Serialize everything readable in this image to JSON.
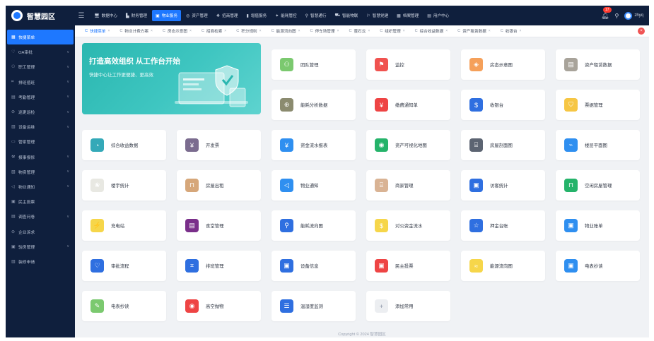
{
  "app": {
    "title": "智慧园区"
  },
  "header": {
    "nav": [
      {
        "label": "数据中心",
        "icon": "monitor-icon",
        "glyph": "🖥"
      },
      {
        "label": "财务管理",
        "icon": "chart-icon",
        "glyph": "▙"
      },
      {
        "label": "物业服务",
        "icon": "briefcase-icon",
        "glyph": "▣",
        "active": true
      },
      {
        "label": "资产管理",
        "icon": "asset-icon",
        "glyph": "◎"
      },
      {
        "label": "招商管理",
        "icon": "handshake-icon",
        "glyph": "❖"
      },
      {
        "label": "增值服务",
        "icon": "bar-icon",
        "glyph": "▮"
      },
      {
        "label": "能耗管控",
        "icon": "leaf-icon",
        "glyph": "✦"
      },
      {
        "label": "智慧通行",
        "icon": "pass-icon",
        "glyph": "⚲"
      },
      {
        "label": "智能物联",
        "icon": "car-icon",
        "glyph": "⛟"
      },
      {
        "label": "智慧党建",
        "icon": "flag-icon",
        "glyph": "⚐"
      },
      {
        "label": "档案管理",
        "icon": "archive-icon",
        "glyph": "▦"
      },
      {
        "label": "用户中心",
        "icon": "user-card-icon",
        "glyph": "▤"
      }
    ],
    "notification_count": "17",
    "username": "zhyq"
  },
  "sidebar": {
    "items": [
      {
        "label": "快捷菜单",
        "icon": "grid-icon",
        "glyph": "▦",
        "active": true,
        "chevron": false
      },
      {
        "label": "OA审批",
        "icon": "heart-icon",
        "glyph": "♡",
        "chevron": true
      },
      {
        "label": "职工管理",
        "icon": "people-icon",
        "glyph": "⚇",
        "chevron": true
      },
      {
        "label": "排班值班",
        "icon": "schedule-icon",
        "glyph": "⌗",
        "chevron": true
      },
      {
        "label": "考勤管理",
        "icon": "calendar-icon",
        "glyph": "▤",
        "chevron": true
      },
      {
        "label": "巡更巡检",
        "icon": "patrol-icon",
        "glyph": "⊘",
        "chevron": true
      },
      {
        "label": "设备运维",
        "icon": "device-icon",
        "glyph": "▥",
        "chevron": true
      },
      {
        "label": "管家管理",
        "icon": "butler-icon",
        "glyph": "▭",
        "chevron": false
      },
      {
        "label": "报事报修",
        "icon": "wrench-icon",
        "glyph": "⚒",
        "chevron": true
      },
      {
        "label": "物资管理",
        "icon": "box-icon",
        "glyph": "▧",
        "chevron": true
      },
      {
        "label": "物业通知",
        "icon": "megaphone-icon",
        "glyph": "◁",
        "chevron": true
      },
      {
        "label": "民主投票",
        "icon": "vote-icon",
        "glyph": "▣",
        "chevron": false
      },
      {
        "label": "调查问卷",
        "icon": "survey-icon",
        "glyph": "▤",
        "chevron": true
      },
      {
        "label": "企业诉求",
        "icon": "request-icon",
        "glyph": "⊖",
        "chevron": false
      },
      {
        "label": "验房管理",
        "icon": "inspect-icon",
        "glyph": "▣",
        "chevron": true
      },
      {
        "label": "装修申请",
        "icon": "renovate-icon",
        "glyph": "▥",
        "chevron": false
      }
    ]
  },
  "tabs": [
    {
      "label": "快捷菜单",
      "active": true
    },
    {
      "label": "物业计费方案"
    },
    {
      "label": "房态示意图"
    },
    {
      "label": "招商检索"
    },
    {
      "label": "积分规则"
    },
    {
      "label": "能源流向图"
    },
    {
      "label": "停车场管理"
    },
    {
      "label": "萤石云"
    },
    {
      "label": "组织管理"
    },
    {
      "label": "综合收益数据"
    },
    {
      "label": "资产租赁数据"
    },
    {
      "label": "收银台"
    }
  ],
  "banner": {
    "title": "打造高效组织 从工作台开始",
    "subtitle": "快捷中心让工作更便捷、更高效"
  },
  "tiles": [
    {
      "label": "团队管理",
      "icon": "team-icon",
      "glyph": "⚇",
      "color": "#7bc96f"
    },
    {
      "label": "监控",
      "icon": "monitor-flag-icon",
      "glyph": "⚑",
      "color": "#f0524f"
    },
    {
      "label": "房态示意图",
      "icon": "tag-icon",
      "glyph": "◈",
      "color": "#f5a05a"
    },
    {
      "label": "资产租赁数据",
      "icon": "document-icon",
      "glyph": "▤",
      "color": "#a8a39a"
    },
    {
      "label": "能耗分析数据",
      "icon": "globe-icon",
      "glyph": "⊕",
      "color": "#8b8b6f"
    },
    {
      "label": "缴费通知单",
      "icon": "bill-icon",
      "glyph": "¥",
      "color": "#ee4444"
    },
    {
      "label": "收银台",
      "icon": "cashier-icon",
      "glyph": "$",
      "color": "#2f6fe0"
    },
    {
      "label": "票据管理",
      "icon": "shield-icon",
      "glyph": "⛉",
      "color": "#f6c644"
    },
    {
      "label": "综合收益数据",
      "icon": "pie-chart-icon",
      "glyph": "◔",
      "color": "#34a9b8"
    },
    {
      "label": "开发票",
      "icon": "invoice-icon",
      "glyph": "¥",
      "color": "#7b6c8f"
    },
    {
      "label": "资金流水报表",
      "icon": "report-icon",
      "glyph": "¥",
      "color": "#2f8ff0"
    },
    {
      "label": "资产可视化地图",
      "icon": "map-pin-icon",
      "glyph": "◉",
      "color": "#25b36a"
    },
    {
      "label": "房屋剖面图",
      "icon": "floor-section-icon",
      "glyph": "⌸",
      "color": "#5c6472"
    },
    {
      "label": "楼层平面图",
      "icon": "line-chart-icon",
      "glyph": "⌁",
      "color": "#2f8ff0"
    },
    {
      "label": "楼宇统计",
      "icon": "building-stats-icon",
      "glyph": "❀",
      "color": "#e8e8e2"
    },
    {
      "label": "房屋出租",
      "icon": "lock-icon",
      "glyph": "⊓",
      "color": "#d6a77a"
    },
    {
      "label": "物业通知",
      "icon": "megaphone-icon",
      "glyph": "◁",
      "color": "#2f8ff0"
    },
    {
      "label": "商家管理",
      "icon": "merchant-icon",
      "glyph": "⌸",
      "color": "#d9b394"
    },
    {
      "label": "访客统计",
      "icon": "visitor-icon",
      "glyph": "▣",
      "color": "#2f6fe0"
    },
    {
      "label": "空闲房屋管理",
      "icon": "lock-open-icon",
      "glyph": "⊓",
      "color": "#25b36a"
    },
    {
      "label": "充电站",
      "icon": "charging-icon",
      "glyph": "⚡",
      "color": "#f6d64a"
    },
    {
      "label": "食堂管理",
      "icon": "canteen-icon",
      "glyph": "▤",
      "color": "#7a2f8a"
    },
    {
      "label": "能耗流向图",
      "icon": "search-flow-icon",
      "glyph": "⚲",
      "color": "#2f6fe0"
    },
    {
      "label": "对公资金流水",
      "icon": "public-fund-icon",
      "glyph": "$",
      "color": "#f6d64a"
    },
    {
      "label": "押金台账",
      "icon": "star-icon",
      "glyph": "☆",
      "color": "#2f6fe0"
    },
    {
      "label": "物业账单",
      "icon": "bill-list-icon",
      "glyph": "▣",
      "color": "#2f8ff0"
    },
    {
      "label": "审批流程",
      "icon": "heart-icon",
      "glyph": "♡",
      "color": "#2f6fe0"
    },
    {
      "label": "排班管理",
      "icon": "schedule-icon",
      "glyph": "⌗",
      "color": "#2f6fe0"
    },
    {
      "label": "设备信息",
      "icon": "device-info-icon",
      "glyph": "▣",
      "color": "#2f6fe0"
    },
    {
      "label": "民主投票",
      "icon": "vote-icon",
      "glyph": "▣",
      "color": "#ee4444"
    },
    {
      "label": "能源流向图",
      "icon": "energy-flow-icon",
      "glyph": "≈",
      "color": "#f6d64a"
    },
    {
      "label": "电表抄读",
      "icon": "meter-icon",
      "glyph": "▣",
      "color": "#2f8ff0"
    },
    {
      "label": "电表抄读",
      "icon": "edit-icon",
      "glyph": "✎",
      "color": "#7bc96f"
    },
    {
      "label": "高空抛物",
      "icon": "eye-icon",
      "glyph": "◉",
      "color": "#ee4444"
    },
    {
      "label": "温湿度监测",
      "icon": "list-icon",
      "glyph": "☰",
      "color": "#2f6fe0"
    },
    {
      "label": "添加常用",
      "icon": "plus-icon",
      "glyph": "+",
      "color": "#eceef1",
      "glyph_color": "#8a93a5"
    }
  ],
  "footer": {
    "copyright": "Copyright © 2024 智慧园区"
  }
}
